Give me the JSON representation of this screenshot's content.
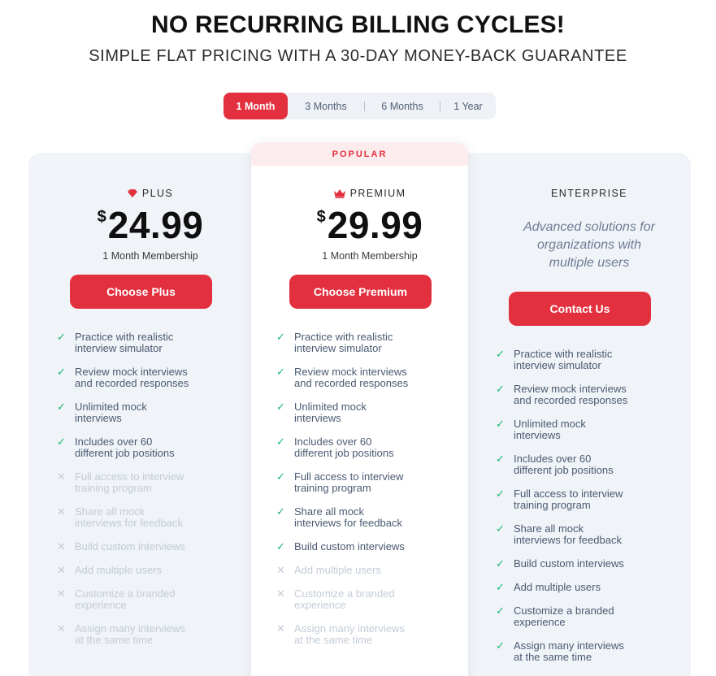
{
  "header": {
    "title": "NO RECURRING BILLING CYCLES!",
    "subtitle": "SIMPLE FLAT PRICING WITH A 30-DAY MONEY-BACK GUARANTEE"
  },
  "periods": [
    {
      "label": "1 Month",
      "active": true
    },
    {
      "label": "3 Months",
      "active": false
    },
    {
      "label": "6 Months",
      "active": false
    },
    {
      "label": "1 Year",
      "active": false
    }
  ],
  "popular_label": "POPULAR",
  "colors": {
    "accent": "#e3303f",
    "check": "#1bb86e",
    "muted": "#c3ccd8"
  },
  "plans": {
    "plus": {
      "name": "PLUS",
      "icon": "diamond-icon",
      "currency": "$",
      "price": "24.99",
      "membership": "1 Month Membership",
      "cta": "Choose Plus",
      "features": [
        {
          "line1": "Practice with realistic",
          "line2": "interview simulator",
          "included": true
        },
        {
          "line1": "Review mock interviews",
          "line2": "and recorded responses",
          "included": true
        },
        {
          "line1": "Unlimited mock",
          "line2": "interviews",
          "included": true
        },
        {
          "line1": "Includes over 60",
          "line2": "different job positions",
          "included": true
        },
        {
          "line1": "Full access to interview",
          "line2": "training program",
          "included": false
        },
        {
          "line1": "Share all mock",
          "line2": "interviews for feedback",
          "included": false
        },
        {
          "line1": "Build custom interviews",
          "line2": "",
          "included": false
        },
        {
          "line1": "Add multiple users",
          "line2": "",
          "included": false
        },
        {
          "line1": "Customize a branded",
          "line2": "experience",
          "included": false
        },
        {
          "line1": "Assign many interviews",
          "line2": "at the same time",
          "included": false
        }
      ]
    },
    "premium": {
      "name": "PREMIUM",
      "icon": "crown-icon",
      "currency": "$",
      "price": "29.99",
      "membership": "1 Month Membership",
      "cta": "Choose Premium",
      "features": [
        {
          "line1": "Practice with realistic",
          "line2": "interview simulator",
          "included": true
        },
        {
          "line1": "Review mock interviews",
          "line2": "and recorded responses",
          "included": true
        },
        {
          "line1": "Unlimited mock",
          "line2": "interviews",
          "included": true
        },
        {
          "line1": "Includes over 60",
          "line2": "different job positions",
          "included": true
        },
        {
          "line1": "Full access to interview",
          "line2": "training program",
          "included": true
        },
        {
          "line1": "Share all mock",
          "line2": "interviews for feedback",
          "included": true
        },
        {
          "line1": "Build custom interviews",
          "line2": "",
          "included": true
        },
        {
          "line1": "Add multiple users",
          "line2": "",
          "included": false
        },
        {
          "line1": "Customize a branded",
          "line2": "experience",
          "included": false
        },
        {
          "line1": "Assign many interviews",
          "line2": "at the same time",
          "included": false
        }
      ]
    },
    "enterprise": {
      "name": "ENTERPRISE",
      "description": [
        "Advanced solutions for",
        "organizations with",
        "multiple users"
      ],
      "cta": "Contact Us",
      "features": [
        {
          "line1": "Practice with realistic",
          "line2": "interview simulator",
          "included": true
        },
        {
          "line1": "Review mock interviews",
          "line2": "and recorded responses",
          "included": true
        },
        {
          "line1": "Unlimited mock",
          "line2": "interviews",
          "included": true
        },
        {
          "line1": "Includes over 60",
          "line2": "different job positions",
          "included": true
        },
        {
          "line1": "Full access to interview",
          "line2": "training program",
          "included": true
        },
        {
          "line1": "Share all mock",
          "line2": "interviews for feedback",
          "included": true
        },
        {
          "line1": "Build custom interviews",
          "line2": "",
          "included": true
        },
        {
          "line1": "Add multiple users",
          "line2": "",
          "included": true
        },
        {
          "line1": "Customize a branded",
          "line2": "experience",
          "included": true
        },
        {
          "line1": "Assign many interviews",
          "line2": "at the same time",
          "included": true
        }
      ]
    }
  }
}
